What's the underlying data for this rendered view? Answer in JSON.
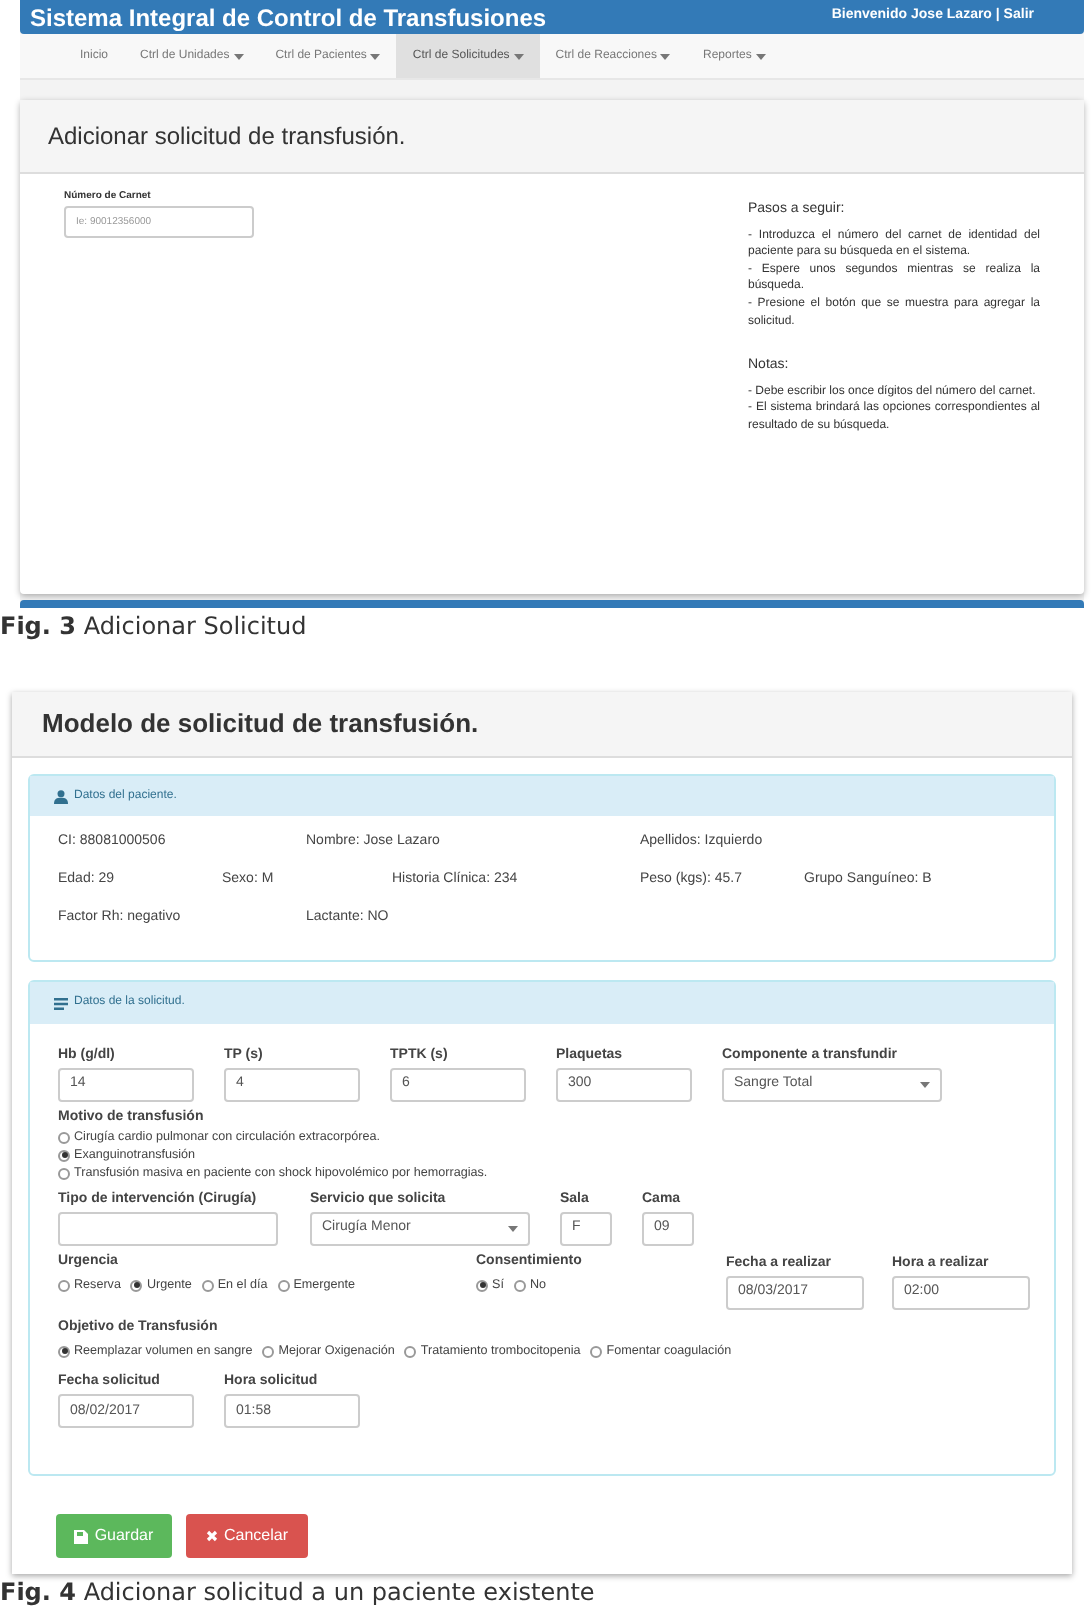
{
  "figure_3": {
    "header": {
      "title": "Sistema Integral de Control de Transfusiones",
      "user_text": "Bienvenido Jose Lazaro | Salir"
    },
    "nav": [
      {
        "label": "Inicio",
        "selected": false,
        "dropdown": false
      },
      {
        "label": "Ctrl de Unidades",
        "selected": false,
        "dropdown": true
      },
      {
        "label": "Ctrl de Pacientes",
        "selected": false,
        "dropdown": true
      },
      {
        "label": "Ctrl de Solicitudes",
        "selected": true,
        "dropdown": true
      },
      {
        "label": "Ctrl de Reacciones",
        "selected": false,
        "dropdown": true
      },
      {
        "label": "Reportes",
        "selected": false,
        "dropdown": true
      }
    ],
    "panel": {
      "title": "Adicionar solicitud de transfusión.",
      "field": {
        "label": "Número de Carnet",
        "placeholder": "Ie: 90012356000"
      },
      "steps_title": "Pasos a seguir:",
      "steps": [
        "- Introduzca el número del carnet de identidad del paciente para su búsqueda en el sistema.",
        "- Espere unos segundos mientras se realiza la búsqueda.",
        "- Presione el botón que se muestra para agregar la solicitud."
      ],
      "notes_title": "Notas:",
      "notes": [
        "- Debe escribir los once dígitos del número del carnet.",
        "- El sistema brindará las opciones correspondientes al resultado de su búsqueda."
      ]
    },
    "caption": "**Fig. 3** Adicionar Solicitud"
  },
  "figure_4": {
    "title": "Modelo de solicitud de transfusión.",
    "patient": {
      "heading": "Datos del paciente.",
      "info": [
        "CI: 88081000506",
        "Nombre: Jose Lazaro",
        "Apellidos: Izquierdo",
        "Edad: 29",
        "Sexo: M",
        "Historia Clínica: 234",
        "Peso (kgs): 45.7",
        "Grupo Sanguíneo: B",
        "Factor Rh: negativo",
        "Lactante: NO"
      ]
    },
    "request": {
      "heading": "Datos de la solicitud.",
      "lab_fields": [
        {
          "label": "Hb (g/dl)",
          "value": "14",
          "kind": "text"
        },
        {
          "label": "TP (s)",
          "value": "4",
          "kind": "text"
        },
        {
          "label": "TPTK (s)",
          "value": "6",
          "kind": "text"
        },
        {
          "label": "Plaquetas",
          "value": "300",
          "kind": "text"
        },
        {
          "label": "Componente a transfundir",
          "value": "Sangre Total",
          "kind": "select"
        }
      ],
      "motivo": {
        "label": "Motivo de transfusión",
        "options": [
          {
            "label": "Cirugía cardio pulmonar con circulación extracorpórea.",
            "selected": false
          },
          {
            "label": "Exanguinotransfusión",
            "selected": true
          },
          {
            "label": "Transfusión masiva en paciente con shock hipovolémico por hemorragias.",
            "selected": false
          }
        ]
      },
      "service_fields": [
        {
          "label": "Tipo de intervención (Cirugía)",
          "kind": "text"
        },
        {
          "label": "Servicio que solicita",
          "value": "Cirugía Menor",
          "kind": "select"
        },
        {
          "label": "Sala",
          "value": "F",
          "kind": "text"
        },
        {
          "label": "Cama",
          "value": "09",
          "kind": "text"
        }
      ],
      "urgencia": {
        "label": "Urgencia",
        "options": [
          {
            "label": "Reserva",
            "selected": false
          },
          {
            "label": "Urgente",
            "selected": true
          },
          {
            "label": "En el día",
            "selected": false
          },
          {
            "label": "Emergente",
            "selected": false
          }
        ]
      },
      "consentimiento": {
        "label": "Consentimiento",
        "options": [
          {
            "label": "Sí",
            "selected": true
          },
          {
            "label": "No",
            "selected": false
          }
        ]
      },
      "fecha_realizar": {
        "label": "Fecha a realizar",
        "value": "08/03/2017"
      },
      "hora_realizar": {
        "label": "Hora a realizar",
        "value": "02:00"
      },
      "objetivo": {
        "label": "Objetivo de Transfusión",
        "options": [
          {
            "label": "Reemplazar volumen en sangre",
            "selected": true
          },
          {
            "label": "Mejorar Oxigenación",
            "selected": false
          },
          {
            "label": "Tratamiento trombocitopenia",
            "selected": false
          },
          {
            "label": "Fomentar coagulación",
            "selected": false
          }
        ]
      },
      "fecha_solicitud": {
        "label": "Fecha solicitud",
        "value": "08/02/2017"
      },
      "hora_solicitud": {
        "label": "Hora solicitud",
        "value": "01:58"
      }
    },
    "buttons": [
      {
        "label": "Guardar",
        "kind": "save"
      },
      {
        "label": "Cancelar",
        "kind": "cancel"
      }
    ],
    "caption": "**Fig. 4** Adicionar solicitud a un paciente existente"
  }
}
